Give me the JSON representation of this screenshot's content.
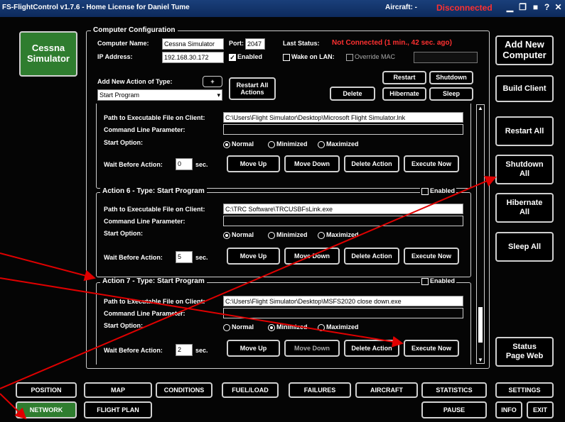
{
  "titlebar": {
    "title": "FS-FlightControl v1.7.6 - Home License for Daniel Tume",
    "aircraft_label": "Aircraft: -",
    "aircraft_status": "Disconnected"
  },
  "left": {
    "computer_button": "Cessna\nSimulator"
  },
  "config": {
    "group_title": "Computer Configuration",
    "computer_name_label": "Computer Name:",
    "computer_name": "Cessna Simulator",
    "port_label": "Port:",
    "port": "2047",
    "last_status_label": "Last Status:",
    "last_status": "Not Connected (1 min., 42 sec. ago)",
    "ip_label": "IP Address:",
    "ip": "192.168.30.172",
    "enabled_label": "Enabled",
    "wake_on_lan_label": "Wake on LAN:",
    "override_mac_label": "Override MAC",
    "add_action_label": "Add New Action of Type:",
    "add_action_button": "+",
    "action_type": "Start Program",
    "restart_all_actions": "Restart All\nActions",
    "delete": "Delete",
    "restart": "Restart",
    "shutdown": "Shutdown",
    "hibernate": "Hibernate",
    "sleep": "Sleep"
  },
  "common": {
    "path_label": "Path to Executable File on Client:",
    "cmd_label": "Command Line Parameter:",
    "start_option_label": "Start Option:",
    "normal": "Normal",
    "minimized": "Minimized",
    "maximized": "Maximized",
    "wait_label": "Wait Before Action:",
    "sec": "sec.",
    "move_up": "Move Up",
    "move_down": "Move Down",
    "delete_action": "Delete Action",
    "execute_now": "Execute Now",
    "enabled": "Enabled"
  },
  "actions": [
    {
      "title": "",
      "path": "C:\\Users\\Flight Simulator\\Desktop\\Microsoft Flight Simulator.lnk",
      "wait": "0"
    },
    {
      "title": "Action 6 - Type: Start Program",
      "path": "C:\\TRC Software\\TRCUSBFsLink.exe",
      "wait": "5"
    },
    {
      "title": "Action 7 - Type: Start Program",
      "path": "C:\\Users\\Flight Simulator\\Desktop\\MSFS2020 close down.exe",
      "wait": "2"
    }
  ],
  "right": {
    "add_new_computer": "Add New\nComputer",
    "build_client": "Build Client",
    "restart_all": "Restart All",
    "shutdown_all": "Shutdown\nAll",
    "hibernate_all": "Hibernate\nAll",
    "sleep_all": "Sleep All",
    "status_page_web": "Status\nPage Web"
  },
  "nav": {
    "position": "POSITION",
    "map": "MAP",
    "conditions": "CONDITIONS",
    "fuel_load": "FUEL/LOAD",
    "failures": "FAILURES",
    "aircraft": "AIRCRAFT",
    "statistics": "STATISTICS",
    "settings": "SETTINGS",
    "network": "NETWORK",
    "flight_plan": "FLIGHT PLAN",
    "pause": "PAUSE",
    "info": "INFO",
    "exit": "EXIT"
  },
  "colors": {
    "accent_green": "#2f7d2f",
    "status_red": "#ff3030",
    "annotation_red": "#e00000",
    "titlebar_blue": "#163a73"
  }
}
